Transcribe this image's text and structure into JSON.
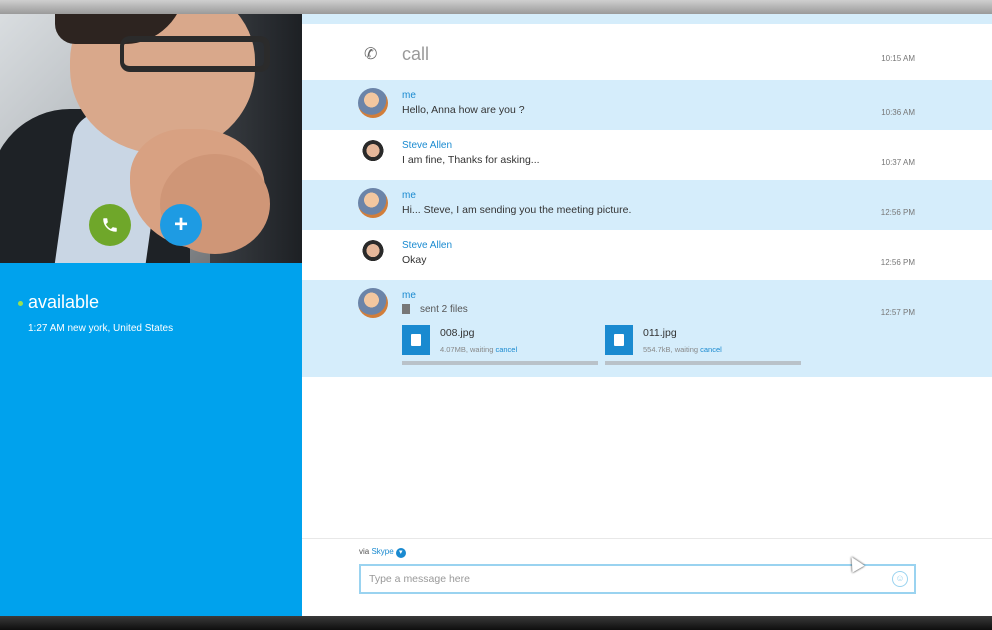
{
  "contact": {
    "status": "available",
    "location": "1:27 AM new york, United States",
    "call_button_icon": "phone-icon",
    "add_button_icon": "plus-icon"
  },
  "conversation": {
    "call_label": "call",
    "call_time": "10:15 AM",
    "messages": [
      {
        "sender": "me",
        "text": "Hello, Anna how are you ?",
        "time": "10:36 AM"
      },
      {
        "sender": "Steve Allen",
        "text": "I am fine, Thanks for asking...",
        "time": "10:37 AM"
      },
      {
        "sender": "me",
        "text": "Hi... Steve, I am sending you the meeting picture.",
        "time": "12:56 PM"
      },
      {
        "sender": "Steve Allen",
        "text": "Okay",
        "time": "12:56 PM"
      },
      {
        "sender": "me",
        "text": "sent 2 files",
        "time": "12:57 PM"
      }
    ],
    "files": [
      {
        "name": "008.jpg",
        "size": "4.07MB, waiting",
        "action": "cancel",
        "progress": 0
      },
      {
        "name": "011.jpg",
        "size": "554.7kB, waiting",
        "action": "cancel",
        "progress": 0
      }
    ]
  },
  "composer": {
    "via": "via",
    "service": "Skype",
    "placeholder": "Type a message here"
  }
}
